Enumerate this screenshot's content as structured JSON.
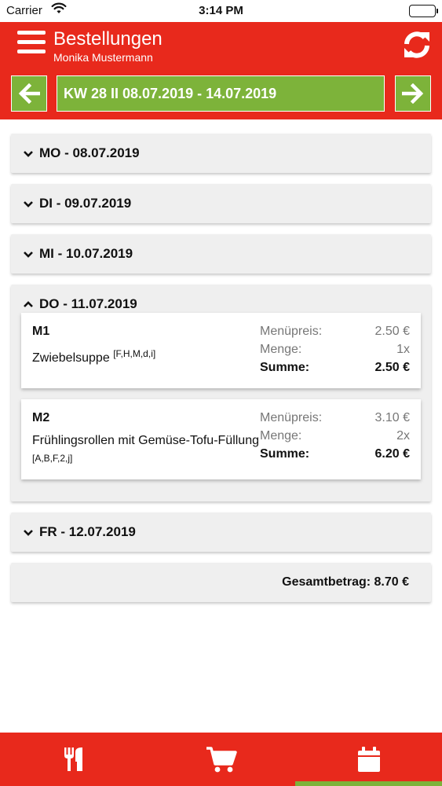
{
  "status": {
    "carrier": "Carrier",
    "time": "3:14 PM"
  },
  "header": {
    "title": "Bestellungen",
    "subtitle": "Monika Mustermann"
  },
  "week": {
    "label": "KW 28 II 08.07.2019 - 14.07.2019"
  },
  "days": [
    {
      "label": "MO - 08.07.2019",
      "expanded": false
    },
    {
      "label": "DI - 09.07.2019",
      "expanded": false
    },
    {
      "label": "MI - 10.07.2019",
      "expanded": false
    },
    {
      "label": "DO - 11.07.2019",
      "expanded": true,
      "orders": [
        {
          "code": "M1",
          "name": "Zwiebelsuppe",
          "allergens": "[F,H,M,d,i]",
          "price_label": "Menüpreis:",
          "price": "2.50 €",
          "qty_label": "Menge:",
          "qty": "1x",
          "sum_label": "Summe:",
          "sum": "2.50 €"
        },
        {
          "code": "M2",
          "name": "Frühlingsrollen mit Gemüse-Tofu-Füllung",
          "allergens": "[A,B,F,2,j]",
          "price_label": "Menüpreis:",
          "price": "3.10 €",
          "qty_label": "Menge:",
          "qty": "2x",
          "sum_label": "Summe:",
          "sum": "6.20 €"
        }
      ]
    },
    {
      "label": "FR - 12.07.2019",
      "expanded": false
    }
  ],
  "total": {
    "label": "Gesamtbetrag: 8.70 €"
  },
  "tabs": [
    {
      "icon": "cutlery-icon"
    },
    {
      "icon": "cart-icon"
    },
    {
      "icon": "calendar-icon",
      "active": true
    }
  ],
  "colors": {
    "brand_red": "#e8291c",
    "accent_green": "#7db33a",
    "card_grey": "#efefef"
  }
}
